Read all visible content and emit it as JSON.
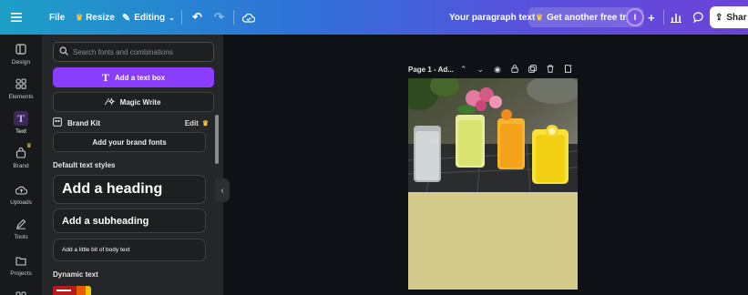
{
  "topbar": {
    "file": "File",
    "resize": "Resize",
    "editing": "Editing",
    "doc_title": "Your paragraph text",
    "trial": "Get another free trial",
    "avatar_initial": "I",
    "share": "Shar"
  },
  "rail": {
    "items": [
      {
        "label": "Design",
        "icon": "layout-icon"
      },
      {
        "label": "Elements",
        "icon": "shapes-icon"
      },
      {
        "label": "Text",
        "icon": "text-icon"
      },
      {
        "label": "Brand",
        "icon": "brand-icon"
      },
      {
        "label": "Uploads",
        "icon": "cloud-upload-icon"
      },
      {
        "label": "Tools",
        "icon": "pen-icon"
      },
      {
        "label": "Projects",
        "icon": "folder-icon"
      }
    ],
    "active": "Text"
  },
  "panel": {
    "search_placeholder": "Search fonts and combinations",
    "add_text_box": "Add a text box",
    "magic_write": "Magic Write",
    "brand_kit": "Brand Kit",
    "edit": "Edit",
    "add_brand_fonts": "Add your brand fonts",
    "default_styles_label": "Default text styles",
    "heading": "Add a heading",
    "subheading": "Add a subheading",
    "body": "Add a little bit of body text",
    "dynamic_label": "Dynamic text"
  },
  "canvas": {
    "page_label": "Page 1 - Ad...",
    "page_color": "#d4ca8c"
  },
  "colors": {
    "accent": "#8b3dff",
    "topbar_start": "#1d9fc7",
    "topbar_end": "#6c43d8"
  }
}
